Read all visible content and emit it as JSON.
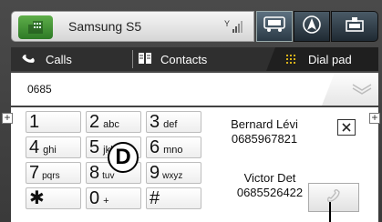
{
  "app": {
    "title": "Samsung S5"
  },
  "tabs": [
    {
      "label": "Calls"
    },
    {
      "label": "Contacts"
    },
    {
      "label": "Dial pad"
    }
  ],
  "dial": {
    "number": "0685"
  },
  "keys": [
    {
      "digit": "1",
      "letters": ""
    },
    {
      "digit": "2",
      "letters": "abc"
    },
    {
      "digit": "3",
      "letters": "def"
    },
    {
      "digit": "4",
      "letters": "ghi"
    },
    {
      "digit": "5",
      "letters": "jkl"
    },
    {
      "digit": "6",
      "letters": "mno"
    },
    {
      "digit": "7",
      "letters": "pqrs"
    },
    {
      "digit": "8",
      "letters": "tuv"
    },
    {
      "digit": "9",
      "letters": "wxyz"
    },
    {
      "digit": "✱",
      "letters": ""
    },
    {
      "digit": "0",
      "letters": "+"
    },
    {
      "digit": "#",
      "letters": ""
    }
  ],
  "contacts": [
    {
      "name": "Bernard Lévi",
      "number": "0685967821"
    },
    {
      "name": "Victor Det",
      "number": "0685526422"
    }
  ],
  "callout": {
    "label": "D"
  },
  "icons": {
    "app": "phone-app-icon",
    "signal": "signal-strength-icon",
    "car": "car-icon",
    "nav": "navigation-icon",
    "media": "media-icon",
    "calls": "phone-icon",
    "contacts": "contacts-icon",
    "dialpad": "dialpad-icon",
    "backspace": "backspace-icon",
    "delete": "delete-icon",
    "call": "call-icon"
  }
}
